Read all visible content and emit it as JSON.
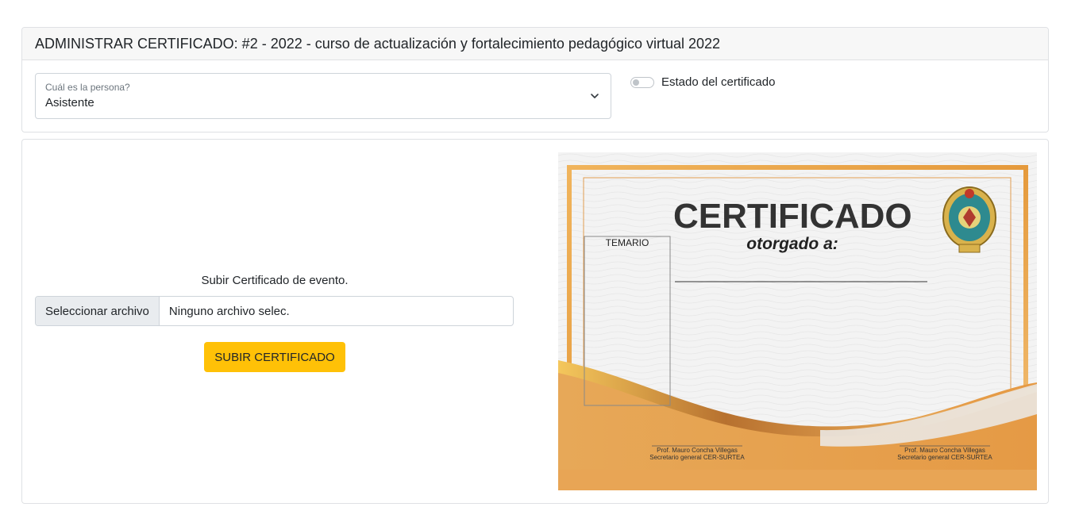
{
  "header": {
    "title": "ADMINISTRAR CERTIFICADO: #2 - 2022 - curso de actualización y fortalecimiento pedagógico virtual 2022"
  },
  "person_select": {
    "label": "Cuál es la persona?",
    "value": "Asistente"
  },
  "status_toggle": {
    "label": "Estado del certificado",
    "checked": false
  },
  "upload": {
    "caption": "Subir Certificado de evento.",
    "choose_label": "Seleccionar archivo",
    "file_name": "Ninguno archivo selec.",
    "button_label": "SUBIR CERTIFICADO"
  },
  "certificate": {
    "title": "CERTIFICADO",
    "subtitle": "otorgado a:",
    "box_label": "TEMARIO",
    "signatures": [
      {
        "name": "Prof. Mauro Concha Villegas",
        "role": "Secretario general CER-SURTEA"
      },
      {
        "name": "Prof. Mauro Concha Villegas",
        "role": "Secretario general CER-SURTEA"
      }
    ]
  },
  "colors": {
    "accent": "#ffc107",
    "gold": "#e5a24a"
  }
}
